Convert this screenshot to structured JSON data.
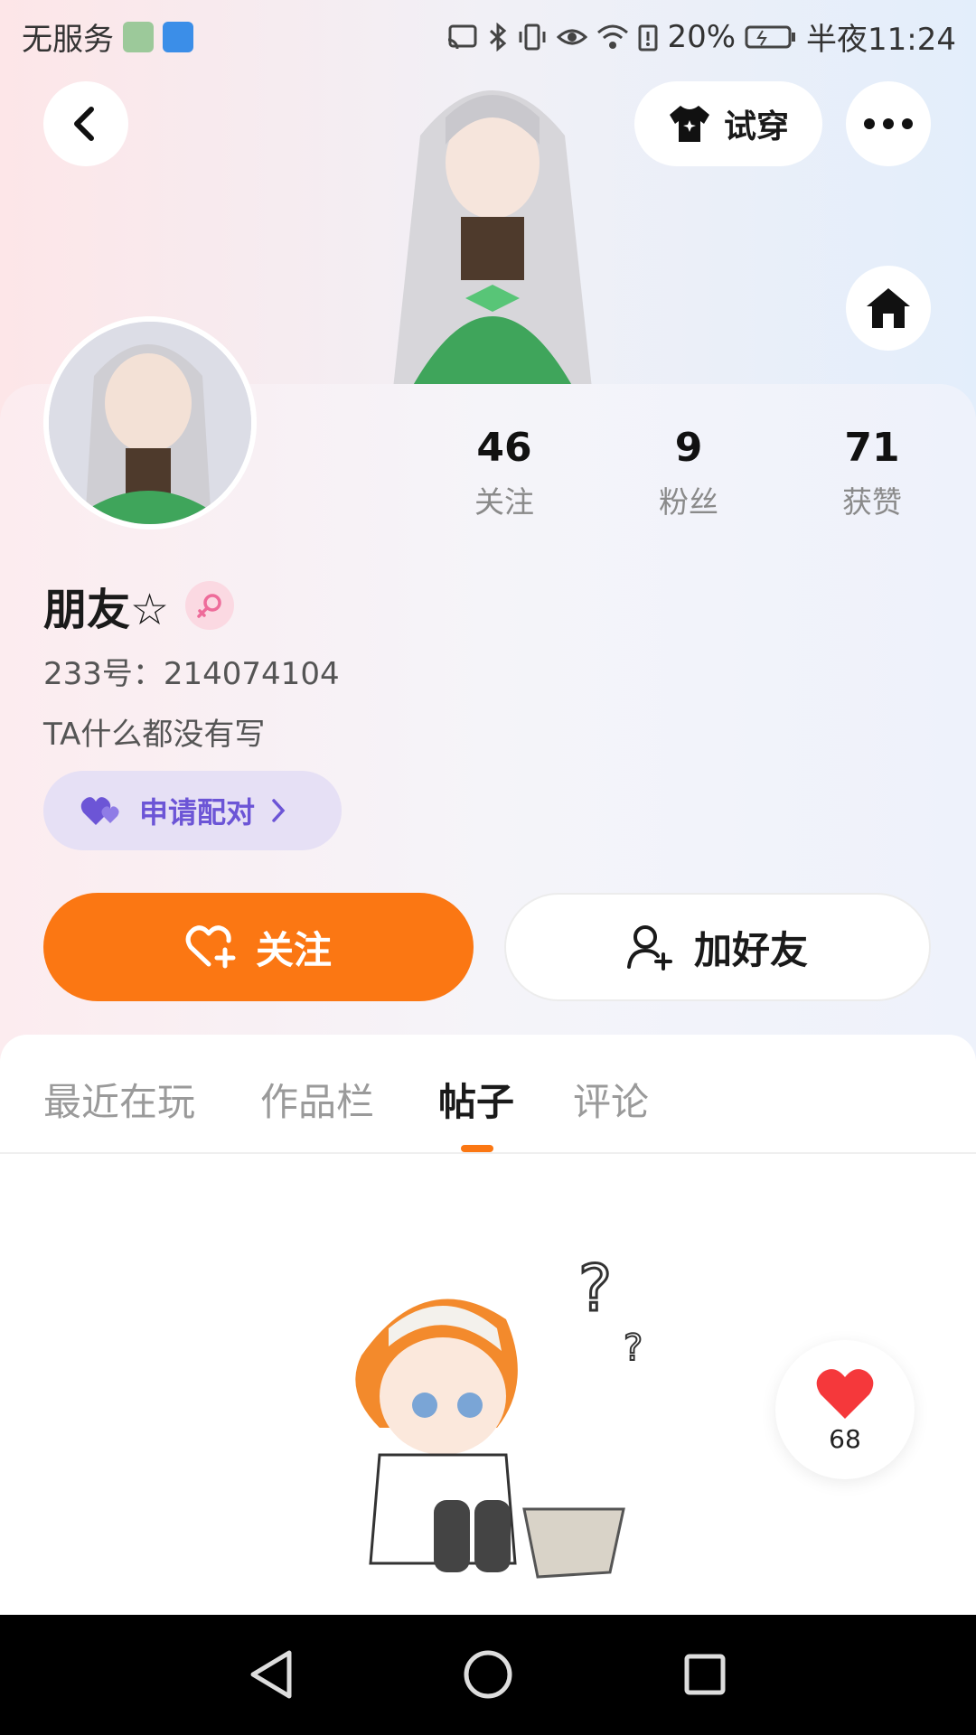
{
  "status_bar": {
    "carrier": "无服务",
    "battery_percent": "20%",
    "time": "半夜11:24"
  },
  "header": {
    "tryon_label": "试穿"
  },
  "profile": {
    "username": "朋友☆",
    "user_id": "233号：214074104",
    "bio": "TA什么都没有写",
    "stats": [
      {
        "value": "46",
        "label": "关注"
      },
      {
        "value": "9",
        "label": "粉丝"
      },
      {
        "value": "71",
        "label": "获赞"
      }
    ],
    "pair_label": "申请配对",
    "follow_label": "关注",
    "add_friend_label": "加好友"
  },
  "tabs": [
    {
      "label": "最近在玩"
    },
    {
      "label": "作品栏"
    },
    {
      "label": "帖子"
    },
    {
      "label": "评论"
    }
  ],
  "active_tab": "帖子",
  "like_float": {
    "count": "68"
  },
  "colors": {
    "accent": "#fb7713",
    "pair_purple": "#6c55d6",
    "pair_bg": "#e6e0f5"
  }
}
